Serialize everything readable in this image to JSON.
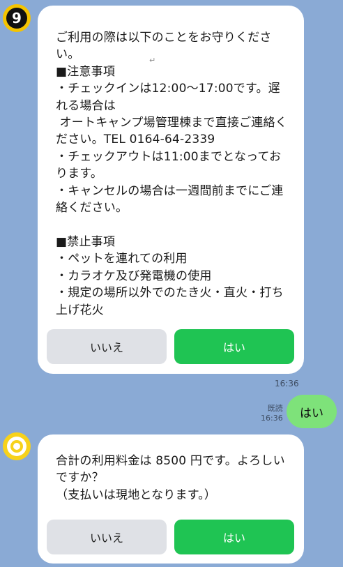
{
  "step_badge": "9",
  "message1": {
    "text": "ご利用の際は以下のことをお守りください。\n■注意事項\n・チェックインは12:00～17:00です。遅れる場合は\n オートキャンプ場管理棟まで直接ご連絡ください。TEL 0164-64-2339\n・チェックアウトは11:00までとなっております。\n・キャンセルの場合は一週間前までにご連絡ください。\n\n■禁止事項\n・ペットを連れての利用\n・カラオケ及び発電機の使用\n・規定の場所以外でのたき火・直火・打ち上げ花火",
    "return_mark": "↵",
    "no_label": "いいえ",
    "yes_label": "はい",
    "time": "16:36"
  },
  "my_reply": {
    "read_label": "既読",
    "time": "16:36",
    "text": "はい"
  },
  "message2": {
    "text": "合計の利用料金は 8500 円です。よろしいですか？\n（支払いは現地となります。）",
    "no_label": "いいえ",
    "yes_label": "はい"
  }
}
